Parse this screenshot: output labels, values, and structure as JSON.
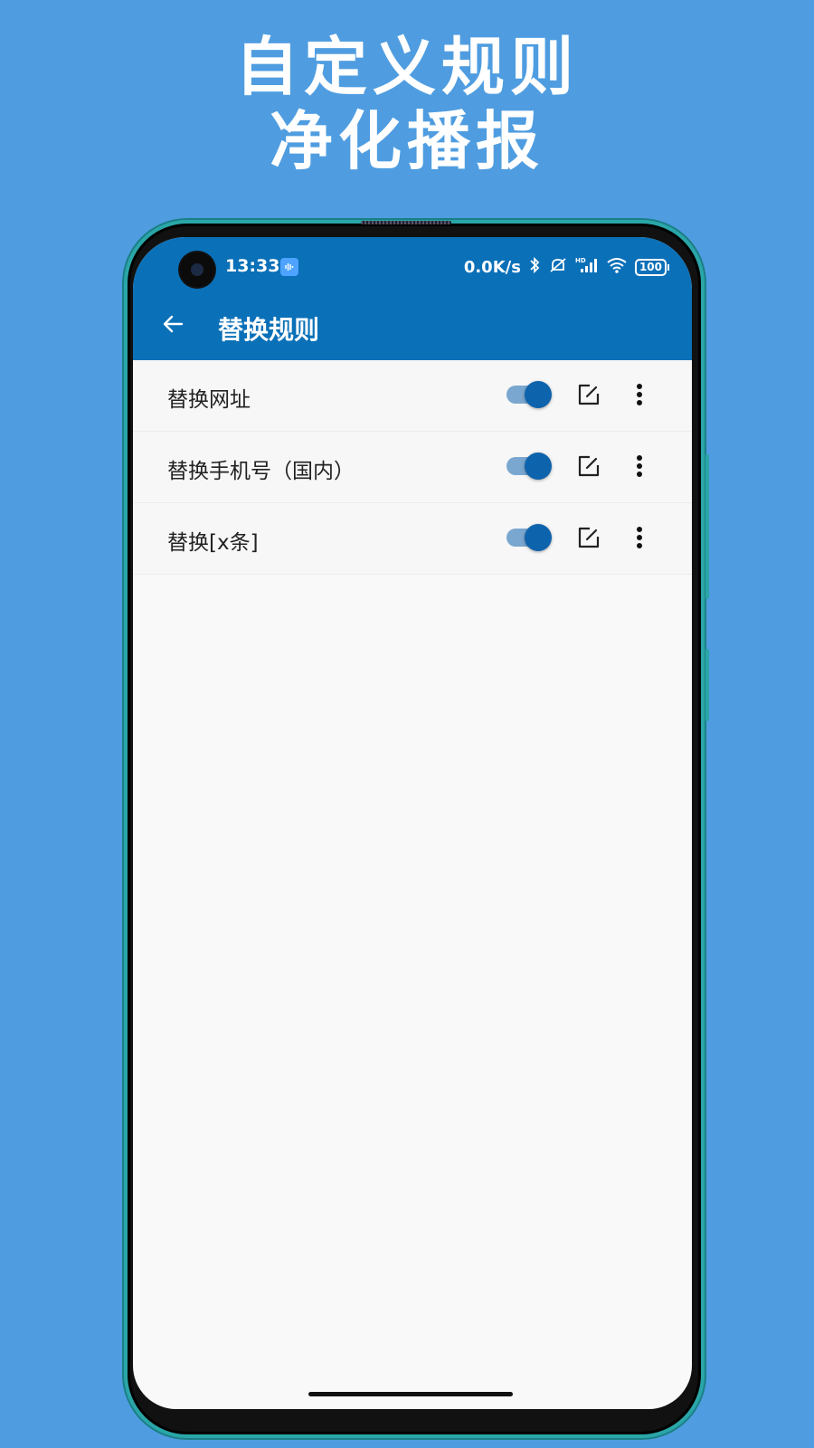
{
  "promo": {
    "line1": "自定义规则",
    "line2": "净化播报"
  },
  "status_bar": {
    "time": "13:33",
    "net_speed": "0.0K/s",
    "battery": "100",
    "icons": [
      "app-notification-icon",
      "bluetooth-icon",
      "silent-icon",
      "signal-hd-icon",
      "wifi-icon",
      "battery-icon"
    ]
  },
  "app_bar": {
    "title": "替换规则",
    "back_icon": "arrow-left-icon"
  },
  "rules": [
    {
      "label": "替换网址",
      "enabled": true
    },
    {
      "label": "替换手机号（国内）",
      "enabled": true
    },
    {
      "label": "替换[x条]",
      "enabled": true
    }
  ],
  "colors": {
    "background": "#4f9de0",
    "primary": "#0a70b8",
    "switch_thumb": "#0e63ad",
    "switch_track": "#7aa7cf",
    "phone_frame": "#2aa6a8"
  }
}
